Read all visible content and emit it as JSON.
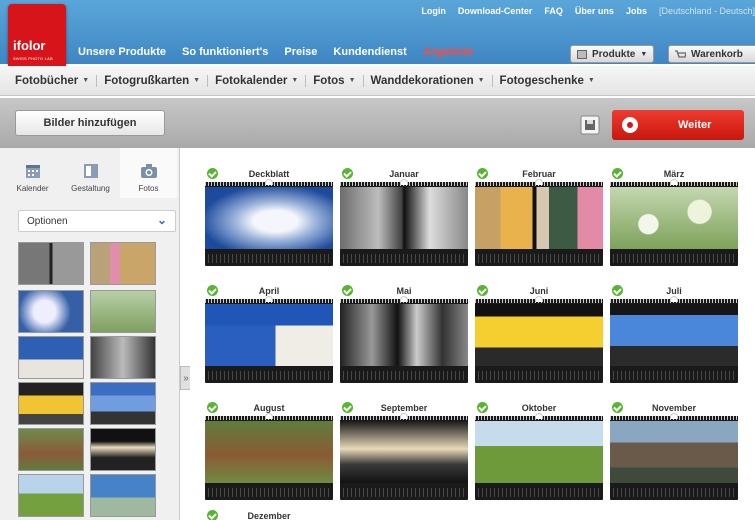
{
  "header": {
    "logo": {
      "brand": "ifolor",
      "tagline": "SWISS PHOTO LAB"
    },
    "top_links": [
      "Login",
      "Download-Center",
      "FAQ",
      "Über uns",
      "Jobs",
      "[Deutschland - Deutsch]"
    ],
    "main_nav": [
      "Unsere Produkte",
      "So funktioniert's",
      "Preise",
      "Kundendienst",
      "Angebote"
    ],
    "products_button": "Produkte",
    "cart_button": "Warenkorb"
  },
  "categories": [
    "Fotobücher",
    "Fotogrußkarten",
    "Fotokalender",
    "Fotos",
    "Wanddekorationen",
    "Fotogeschenke"
  ],
  "toolbar": {
    "add_photos": "Bilder hinzufügen",
    "next": "Weiter"
  },
  "panel": {
    "tabs": [
      {
        "label": "Kalender",
        "icon": "calendar-icon"
      },
      {
        "label": "Gestaltung",
        "icon": "layout-icon"
      },
      {
        "label": "Fotos",
        "icon": "camera-icon"
      }
    ],
    "active_tab": "Fotos",
    "options_dropdown": "Optionen"
  },
  "calendar_pages": [
    {
      "label": "Deckblatt",
      "checked": true
    },
    {
      "label": "Januar",
      "checked": true
    },
    {
      "label": "Februar",
      "checked": true
    },
    {
      "label": "März",
      "checked": true
    },
    {
      "label": "April",
      "checked": true
    },
    {
      "label": "Mai",
      "checked": true
    },
    {
      "label": "Juni",
      "checked": true
    },
    {
      "label": "Juli",
      "checked": true
    },
    {
      "label": "August",
      "checked": true
    },
    {
      "label": "September",
      "checked": true
    },
    {
      "label": "Oktober",
      "checked": true
    },
    {
      "label": "November",
      "checked": true
    },
    {
      "label": "Dezember",
      "checked": true
    }
  ],
  "colors": {
    "header_blue": "#3f86c3",
    "brand_red": "#d8141b",
    "check_green": "#58b531"
  }
}
